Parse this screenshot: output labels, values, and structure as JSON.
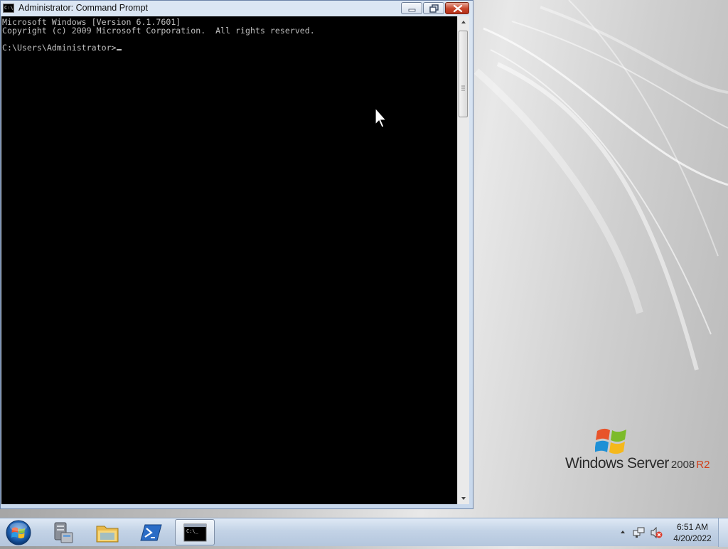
{
  "window": {
    "title": "Administrator: Command Prompt",
    "icon": "cmd-icon",
    "controls": [
      "minimize-icon",
      "restore-icon",
      "close-icon"
    ]
  },
  "console": {
    "lines": [
      "Microsoft Windows [Version 6.1.7601]",
      "Copyright (c) 2009 Microsoft Corporation.  All rights reserved.",
      "",
      "C:\\Users\\Administrator>"
    ],
    "foreground": "#c0c0c0",
    "background": "#000000"
  },
  "desktop": {
    "brand_name": "Windows Server",
    "brand_version": "2008",
    "brand_edition": "R2",
    "edition_color": "#d0401b"
  },
  "taskbar": {
    "pinned": [
      {
        "name": "server-manager-icon"
      },
      {
        "name": "windows-explorer-icon"
      },
      {
        "name": "powershell-icon"
      },
      {
        "name": "command-prompt-icon",
        "active": true
      }
    ],
    "tray_icons": [
      "show-hidden-icons-chevron",
      "network-icon",
      "volume-muted-icon"
    ],
    "clock_time": "6:51 AM",
    "clock_date": "4/20/2022"
  }
}
